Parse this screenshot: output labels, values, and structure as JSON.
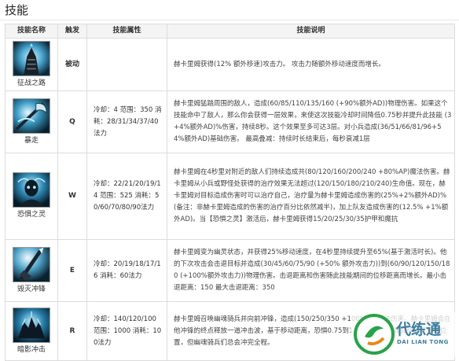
{
  "section_title": "技能",
  "headers": {
    "name": "技能名称",
    "key": "触发",
    "attr": "技能属性",
    "desc": "技能说明"
  },
  "skills": [
    {
      "name": "征战之路",
      "icon": "gauntlet-icon",
      "key": "被动",
      "attr": "",
      "desc": "赫卡里姆获得(12% 额外移速)攻击力。 攻击力随额外移动速度而增长。"
    },
    {
      "name": "暴走",
      "icon": "halberd-icon",
      "key": "Q",
      "attr": "冷却：4 范围：350 消耗：28/31/34/37/40法力",
      "desc": "赫卡里姆猛踏周围的敌人，造成(60/85/110/135/160 (+90%额外AD))物理伤害。如果这个技能命中了敌人，那么你会获得一层效果，来使这次技能冷却时间降低0.75秒并提升此技能 (3+4%额外AD)%伤害，持续8秒。这个效果至多可达3层。对小兵造成(36/51/66/81/96+54%额外AD)基础伤害。 最高叠减：持续时长结束后，每秒衰减1层"
    },
    {
      "name": "恐惧之灵",
      "icon": "spirit-icon",
      "key": "W",
      "attr": "冷却：22/21/20/19/14 范围：525 消耗：50/60/70/80/90法力",
      "desc": "赫卡里姆在4秒里对附近的敌人们持续造成共(80/120/160/200/240 +80%AP)魔法伤害。赫卡里姆从小兵或野怪处获得的治疗效果无法超过(120/150/180/210/240)生命值。现在，赫卡里姆对目标造成伤害时可以治疗自己，治疗量为赫卡里姆造成伤害的(25%+2%额外AD)%(备注：非赫卡里姆造成的伤害的治疗百分比依然减半)，加上队友造成伤害的(12.5% +1%额外AD)。当【恐惧之灵】激活后，赫卡里姆获得15/20/25/30/35护甲和魔抗"
    },
    {
      "name": "毁灭冲锋",
      "icon": "lance-icon",
      "key": "E",
      "attr": "冷却：20/19/18/17/16 消耗：60法力",
      "desc": "赫卡里姆变为幽灵状态，并获得25%移动速度，在4秒里持续提升至65%(基于激活时长)。他的下次攻击会击退目标并造成(30/45/60/75/90 (+50% 额外攻击力))到(60/90/120/150/180 (+100%额外攻击力))物理伤害。击退距离和伤害随此技能期间的位移距离而增长。最小击退距离：150 最大击退距离：350"
    },
    {
      "name": "暗影冲击",
      "icon": "riders-icon",
      "key": "R",
      "attr": "冷却：140/120/100 范围：1000 消耗：100法力",
      "desc": "赫卡里姆召唤幽魂骑兵并向前冲锋，造成(150/250/350 +100%AP)魔法伤害。赫卡里姆会在他冲锋的终点释放一道冲击波，基于移动距离，恐惧0.75到1.5秒。幽魂骑兵会移动至目标位置，但幽魂骑兵们总会冲完全程。"
    }
  ],
  "watermark": {
    "text": "代练通",
    "sub": "DAI LIAN TONG"
  }
}
